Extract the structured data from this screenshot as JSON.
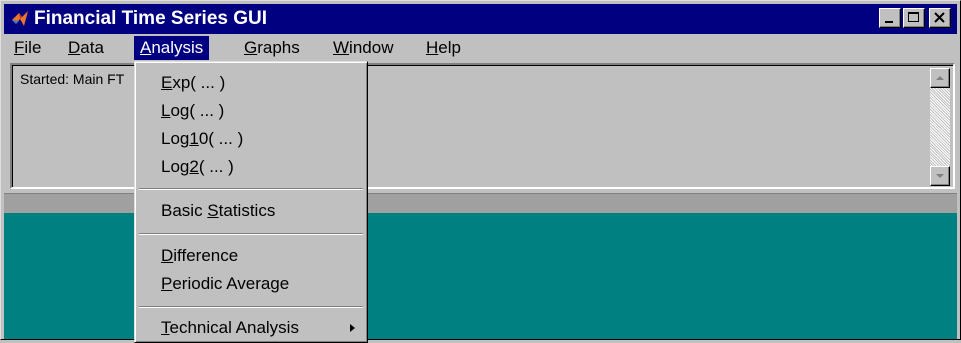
{
  "window": {
    "title": "Financial Time Series GUI",
    "icon": "matlab-icon"
  },
  "menubar": {
    "items": [
      {
        "pre": "",
        "u": "F",
        "post": "ile"
      },
      {
        "pre": "",
        "u": "D",
        "post": "ata"
      },
      {
        "pre": "",
        "u": "A",
        "post": "nalysis"
      },
      {
        "pre": "",
        "u": "G",
        "post": "raphs"
      },
      {
        "pre": "",
        "u": "W",
        "post": "indow"
      },
      {
        "pre": "",
        "u": "H",
        "post": "elp"
      }
    ],
    "active_index": 2
  },
  "log": {
    "text": "Started: Main FT"
  },
  "analysis_menu": {
    "items": [
      {
        "pre": "",
        "u": "E",
        "post": "xp( ... )"
      },
      {
        "pre": "",
        "u": "L",
        "post": "og( ... )"
      },
      {
        "pre": "Log",
        "u": "1",
        "post": "0( ... )"
      },
      {
        "pre": "Log",
        "u": "2",
        "post": "( ... )"
      },
      {
        "pre": "Basic ",
        "u": "S",
        "post": "tatistics"
      },
      {
        "pre": "",
        "u": "D",
        "post": "ifference"
      },
      {
        "pre": "",
        "u": "P",
        "post": "eriodic Average"
      },
      {
        "pre": "",
        "u": "T",
        "post": "echnical Analysis"
      }
    ]
  },
  "colors": {
    "titlebar": "#000080",
    "face": "#c0c0c0",
    "canvas": "#008080",
    "highlight": "#000080"
  }
}
